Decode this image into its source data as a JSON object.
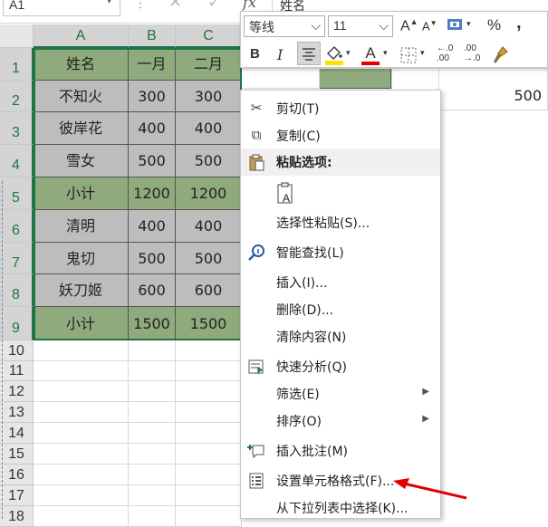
{
  "formula_bar": {
    "name_box": "A1",
    "fx_label": "fx",
    "formula_text": "姓名"
  },
  "columns": [
    "A",
    "B",
    "C"
  ],
  "rows": [
    "1",
    "2",
    "3",
    "4",
    "5",
    "6",
    "7",
    "8",
    "9",
    "10",
    "11",
    "12",
    "13",
    "14",
    "15",
    "16",
    "17",
    "18"
  ],
  "table": {
    "header": [
      "姓名",
      "一月",
      "二月"
    ],
    "body": [
      [
        "不知火",
        "300",
        "300"
      ],
      [
        "彼岸花",
        "400",
        "400"
      ],
      [
        "雪女",
        "500",
        "500"
      ],
      [
        "小计",
        "1200",
        "1200"
      ],
      [
        "清明",
        "400",
        "400"
      ],
      [
        "鬼切",
        "500",
        "500"
      ],
      [
        "妖刀姬",
        "600",
        "600"
      ],
      [
        "小计",
        "1500",
        "1500"
      ]
    ],
    "row2_partial_values": [
      "300",
      "300"
    ],
    "far_right_value": "500"
  },
  "mini_toolbar": {
    "font_name": "等线",
    "font_size": "11",
    "grow_font": "A",
    "shrink_font": "A",
    "percent": "%",
    "comma": ",",
    "bold": "B",
    "italic": "I",
    "font_color_letter": "A",
    "inc_decimal_top": "←.0",
    "inc_decimal_bottom": ".00",
    "dec_decimal_top": ".00",
    "dec_decimal_bottom": "→.0",
    "highlight_color": "#ffe000",
    "font_color": "#e00000"
  },
  "context_menu": {
    "items": [
      {
        "label": "剪切(T)",
        "icon": "scissors-icon"
      },
      {
        "label": "复制(C)",
        "icon": "copy-icon"
      },
      {
        "label": "粘贴选项:",
        "icon": "paste-icon"
      },
      {
        "label": "",
        "icon": "paste-keep-format-icon"
      },
      {
        "label": "选择性粘贴(S)...",
        "icon": ""
      },
      {
        "label": "智能查找(L)",
        "icon": "smart-lookup-icon"
      },
      {
        "label": "插入(I)...",
        "icon": ""
      },
      {
        "label": "删除(D)...",
        "icon": ""
      },
      {
        "label": "清除内容(N)",
        "icon": ""
      },
      {
        "label": "快速分析(Q)",
        "icon": "quick-analysis-icon"
      },
      {
        "label": "筛选(E)",
        "icon": ""
      },
      {
        "label": "排序(O)",
        "icon": ""
      },
      {
        "label": "插入批注(M)",
        "icon": "insert-comment-icon"
      },
      {
        "label": "设置单元格格式(F)...",
        "icon": "format-cells-icon"
      },
      {
        "label": "从下拉列表中选择(K)...",
        "icon": ""
      }
    ]
  },
  "colors": {
    "green_fill": "#8faa7c",
    "gray_fill": "#bdbdbd",
    "accent": "#217346",
    "arrow": "#e00000"
  }
}
